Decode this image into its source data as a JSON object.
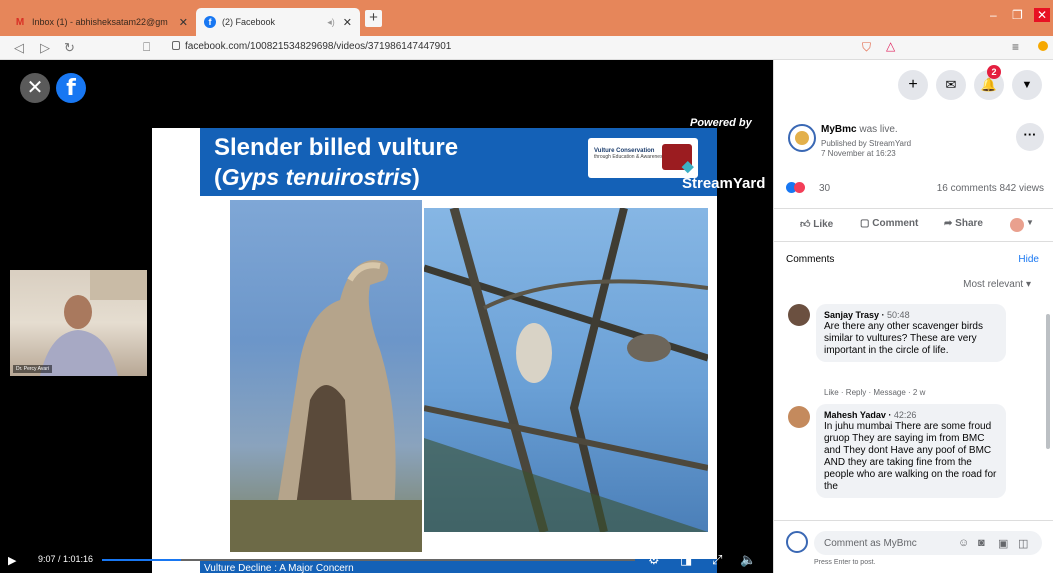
{
  "browser": {
    "tabs": [
      {
        "label": "Inbox (1) - abhisheksatam22@gm",
        "icon": "gmail-icon"
      },
      {
        "label": "(2) Facebook",
        "icon": "facebook-icon"
      }
    ],
    "new_tab_label": "+",
    "address": "facebook.com/100821534829698/videos/371986147447901",
    "min_label": "–",
    "max_label": "❐",
    "close_label": "✕"
  },
  "video": {
    "powered_by": "Powered by",
    "streamyard": "StreamYard",
    "slide_title_line1": "Slender billed vulture",
    "slide_title_line2": "Gyps tenuirostris",
    "slide_logo_text": "Vulture Conservation",
    "slide_logo_sub": "through Education & Awareness",
    "slide_footer": "Vulture Decline : A Major Concern",
    "cam_name": "Dr. Percy Avari",
    "time": "9:07 / 1:01:16",
    "progress": 0.149
  },
  "post": {
    "page_name": "MyBmc",
    "status": " was live.",
    "published_by": "Published by StreamYard",
    "date": "7 November at 16:23",
    "reaction_count": "30",
    "comments_views": "16 comments  842 views",
    "actions": [
      "Like",
      "Comment",
      "Share"
    ],
    "comments_label": "Comments",
    "hide_label": "Hide",
    "sort_label": "Most relevant"
  },
  "comments": [
    {
      "author": "Sanjay Trasy",
      "time": "50:48",
      "text": "Are there any other scavenger birds similar to vultures? These are very important in the circle of life.",
      "meta": "Like · Reply · Message · 2 w"
    },
    {
      "author": "Mahesh Yadav",
      "time": "42:26",
      "text": "In juhu mumbai There are some froud gruop They are saying im from BMC and They dont Have any poof of BMC AND they are taking fine from the people who are walking on the road for the",
      "meta": ""
    }
  ],
  "compose": {
    "placeholder": "Comment as MyBmc",
    "hint": "Press Enter to post."
  },
  "notification_count": "2",
  "colors": {
    "tabbar": "#e6865a",
    "facebook_blue": "#1877f2",
    "slide_blue": "#1461b7"
  }
}
